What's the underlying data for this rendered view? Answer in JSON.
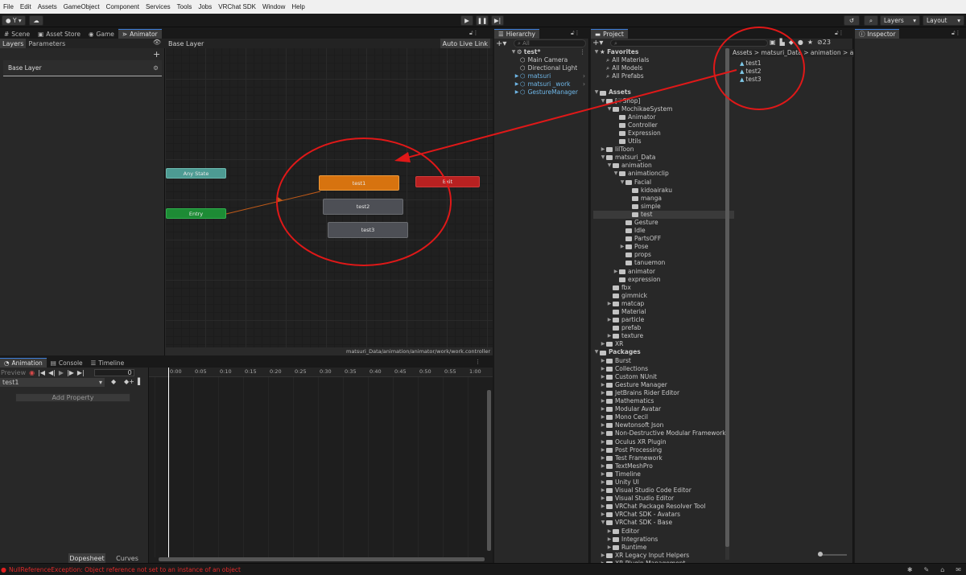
{
  "menu": [
    "File",
    "Edit",
    "Assets",
    "GameObject",
    "Component",
    "Services",
    "Tools",
    "Jobs",
    "VRChat SDK",
    "Window",
    "Help"
  ],
  "toolbar": {
    "account": "Y",
    "layers": "Layers",
    "layout": "Layout"
  },
  "tabs": {
    "scene": "Scene",
    "asset_store": "Asset Store",
    "game": "Game",
    "animator": "Animator",
    "hierarchy": "Hierarchy",
    "project": "Project",
    "inspector": "Inspector",
    "animation": "Animation",
    "console": "Console",
    "timeline": "Timeline"
  },
  "animator": {
    "layers_tab": "Layers",
    "parameters_tab": "Parameters",
    "breadcrumb": "Base Layer",
    "auto_live_link": "Auto Live Link",
    "layer_name": "Base Layer",
    "path": "matsuri_Data/animation/animator/work/work.controller",
    "states": {
      "any": "Any State",
      "entry": "Entry",
      "exit": "Exit",
      "test1": "test1",
      "test2": "test2",
      "test3": "test3"
    }
  },
  "animation": {
    "preview": "Preview",
    "frame": "0",
    "clip": "test1",
    "add_property": "Add Property",
    "dopesheet": "Dopesheet",
    "curves": "Curves",
    "ticks": [
      "0:00",
      "0:05",
      "0:10",
      "0:15",
      "0:20",
      "0:25",
      "0:30",
      "0:35",
      "0:40",
      "0:45",
      "0:50",
      "0:55",
      "1:00"
    ]
  },
  "hierarchy": {
    "search": "All",
    "scene": "test*",
    "items": [
      {
        "label": "Main Camera",
        "prefab": false
      },
      {
        "label": "Directional Light",
        "prefab": false
      },
      {
        "label": "matsuri",
        "prefab": true
      },
      {
        "label": "matsuri _work",
        "prefab": true
      },
      {
        "label": "GestureManager",
        "prefab": true
      }
    ]
  },
  "project": {
    "count": "23",
    "breadcrumb": [
      "Assets",
      "matsuri_Data",
      "animation",
      "ani"
    ],
    "files": [
      "test1",
      "test2",
      "test3"
    ],
    "favorites_header": "Favorites",
    "favorites": [
      "All Materials",
      "All Models",
      "All Prefabs"
    ],
    "assets_header": "Assets",
    "assets": [
      {
        "d": 1,
        "t": "[♡Shop]",
        "o": true
      },
      {
        "d": 2,
        "t": "MochikaeSystem",
        "o": true
      },
      {
        "d": 3,
        "t": "Animator"
      },
      {
        "d": 3,
        "t": "Controller"
      },
      {
        "d": 3,
        "t": "Expression"
      },
      {
        "d": 3,
        "t": "Utils"
      },
      {
        "d": 1,
        "t": "lilToon",
        "c": true
      },
      {
        "d": 1,
        "t": "matsuri_Data",
        "o": true
      },
      {
        "d": 2,
        "t": "animation",
        "o": true
      },
      {
        "d": 3,
        "t": "animationclip",
        "o": true
      },
      {
        "d": 4,
        "t": "Facial",
        "o": true
      },
      {
        "d": 5,
        "t": "kidoairaku"
      },
      {
        "d": 5,
        "t": "manga"
      },
      {
        "d": 5,
        "t": "simple"
      },
      {
        "d": 5,
        "t": "test",
        "sel": true
      },
      {
        "d": 4,
        "t": "Gesture"
      },
      {
        "d": 4,
        "t": "Idle"
      },
      {
        "d": 4,
        "t": "PartsOFF"
      },
      {
        "d": 4,
        "t": "Pose",
        "c": true
      },
      {
        "d": 4,
        "t": "props"
      },
      {
        "d": 4,
        "t": "tanuemon"
      },
      {
        "d": 3,
        "t": "animator",
        "c": true
      },
      {
        "d": 3,
        "t": "expression"
      },
      {
        "d": 2,
        "t": "fbx"
      },
      {
        "d": 2,
        "t": "gimmick"
      },
      {
        "d": 2,
        "t": "matcap",
        "c": true
      },
      {
        "d": 2,
        "t": "Material"
      },
      {
        "d": 2,
        "t": "particle",
        "c": true
      },
      {
        "d": 2,
        "t": "prefab"
      },
      {
        "d": 2,
        "t": "texture",
        "c": true
      },
      {
        "d": 1,
        "t": "XR",
        "c": true
      }
    ],
    "packages_header": "Packages",
    "packages": [
      "Burst",
      "Collections",
      "Custom NUnit",
      "Gesture Manager",
      "JetBrains Rider Editor",
      "Mathematics",
      "Modular Avatar",
      "Mono Cecil",
      "Newtonsoft Json",
      "Non-Destructive Modular Framework",
      "Oculus XR Plugin",
      "Post Processing",
      "Test Framework",
      "TextMeshPro",
      "Timeline",
      "Unity UI",
      "Visual Studio Code Editor",
      "Visual Studio Editor",
      "VRChat Package Resolver Tool",
      "VRChat SDK - Avatars"
    ],
    "vrchat_base": "VRChat SDK - Base",
    "vrchat_base_children": [
      "Editor",
      "Integrations",
      "Runtime"
    ],
    "tail": [
      "XR Legacy Input Helpers",
      "XR Plugin Management"
    ]
  },
  "status": {
    "error": "NullReferenceException: Object reference not set to an instance of an object"
  },
  "colors": {
    "annotation": "#e01818",
    "accent": "#3c7dd9",
    "exit": "#b81f1f",
    "entry": "#1c8a34",
    "default_state": "#d27010",
    "any": "#4a9a90"
  }
}
